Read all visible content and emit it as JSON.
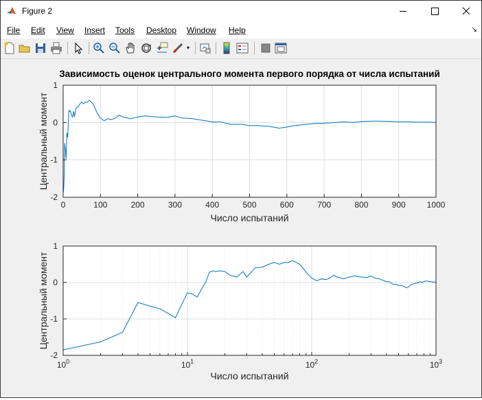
{
  "window": {
    "title": "Figure 2"
  },
  "menu": [
    "File",
    "Edit",
    "View",
    "Insert",
    "Tools",
    "Desktop",
    "Window",
    "Help"
  ],
  "toolbar_icons": [
    "new-figure-icon",
    "open-file-icon",
    "save-icon",
    "print-icon",
    "select-arrow-icon",
    "zoom-in-icon",
    "zoom-out-icon",
    "pan-hand-icon",
    "rotate-3d-icon",
    "data-cursor-icon",
    "brush-icon",
    "link-plot-icon",
    "colorbar-icon",
    "legend-icon",
    "hide-plot-tools-icon",
    "show-plot-tools-icon"
  ],
  "chart_data": [
    {
      "type": "line",
      "title": "Зависимость оценок центрального момента первого порядка от числа испытаний",
      "xlabel": "Число испытаний",
      "ylabel": "Центральный момент",
      "xscale": "linear",
      "xlim": [
        0,
        1000
      ],
      "ylim": [
        -2,
        1
      ],
      "xticks": [
        0,
        100,
        200,
        300,
        400,
        500,
        600,
        700,
        800,
        900,
        1000
      ],
      "xtick_labels": [
        "0",
        "100",
        "200",
        "300",
        "400",
        "500",
        "600",
        "700",
        "800",
        "900",
        "1000"
      ],
      "yticks": [
        -2,
        -1,
        0,
        1
      ],
      "ytick_labels": [
        "-2",
        "-1",
        "0",
        "1"
      ],
      "grid": true,
      "color": "#0072bd",
      "x": [
        1,
        2,
        3,
        4,
        5,
        6,
        7,
        8,
        9,
        10,
        11,
        12,
        13,
        14,
        15,
        16,
        17,
        18,
        20,
        22,
        25,
        28,
        30,
        35,
        40,
        45,
        50,
        55,
        60,
        65,
        70,
        75,
        80,
        85,
        90,
        95,
        100,
        110,
        120,
        130,
        140,
        150,
        160,
        180,
        200,
        220,
        250,
        280,
        300,
        320,
        350,
        380,
        400,
        420,
        450,
        480,
        500,
        520,
        550,
        580,
        600,
        620,
        650,
        680,
        700,
        730,
        750,
        780,
        800,
        830,
        850,
        880,
        900,
        930,
        950,
        980,
        1000
      ],
      "y": [
        -1.85,
        -1.63,
        -1.37,
        -0.55,
        -0.65,
        -0.72,
        -0.85,
        -0.97,
        -0.6,
        -0.28,
        -0.32,
        -0.4,
        -0.18,
        0.0,
        0.28,
        0.32,
        0.3,
        0.32,
        0.3,
        0.2,
        0.15,
        0.3,
        0.15,
        0.4,
        0.42,
        0.5,
        0.55,
        0.5,
        0.55,
        0.55,
        0.6,
        0.55,
        0.5,
        0.4,
        0.28,
        0.2,
        0.12,
        0.05,
        0.1,
        0.08,
        0.12,
        0.2,
        0.15,
        0.1,
        0.15,
        0.18,
        0.15,
        0.14,
        0.18,
        0.12,
        0.1,
        0.05,
        0.02,
        0.02,
        -0.05,
        -0.05,
        -0.08,
        -0.08,
        -0.1,
        -0.15,
        -0.12,
        -0.08,
        -0.05,
        -0.02,
        -0.02,
        0.0,
        0.02,
        0.0,
        0.03,
        0.04,
        0.04,
        0.03,
        0.02,
        0.02,
        0.01,
        0.01,
        0.0
      ]
    },
    {
      "type": "line",
      "xlabel": "Число испытаний",
      "ylabel": "Центральный момент",
      "xscale": "log",
      "xlim": [
        1,
        1000
      ],
      "ylim": [
        -2,
        1
      ],
      "xticks": [
        1,
        10,
        100,
        1000
      ],
      "xtick_labels": [
        "10",
        "10",
        "10",
        "10"
      ],
      "xtick_exponents": [
        "0",
        "1",
        "2",
        "3"
      ],
      "yticks": [
        -2,
        -1,
        0,
        1
      ],
      "ytick_labels": [
        "-2",
        "-1",
        "0",
        "1"
      ],
      "grid": true,
      "color": "#0072bd",
      "series_ref": 0
    }
  ]
}
